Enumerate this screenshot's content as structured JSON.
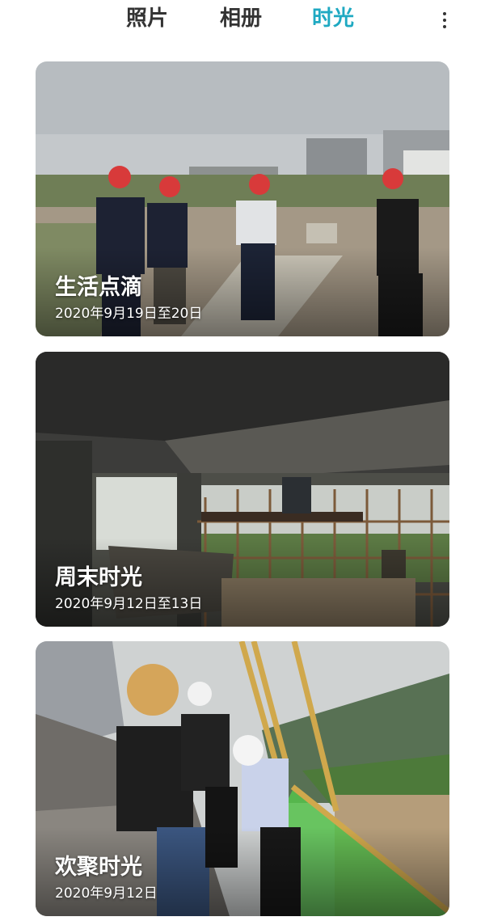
{
  "header": {
    "tabs": [
      {
        "label": "照片",
        "active": false
      },
      {
        "label": "相册",
        "active": false
      },
      {
        "label": "时光",
        "active": true
      }
    ],
    "more_icon": "more-vertical-icon",
    "active_color": "#1fa9c2"
  },
  "moments": [
    {
      "title": "生活点滴",
      "date": "2020年9月19日至20日"
    },
    {
      "title": "周末时光",
      "date": "2020年9月12日至13日"
    },
    {
      "title": "欢聚时光",
      "date": "2020年9月12日"
    }
  ]
}
